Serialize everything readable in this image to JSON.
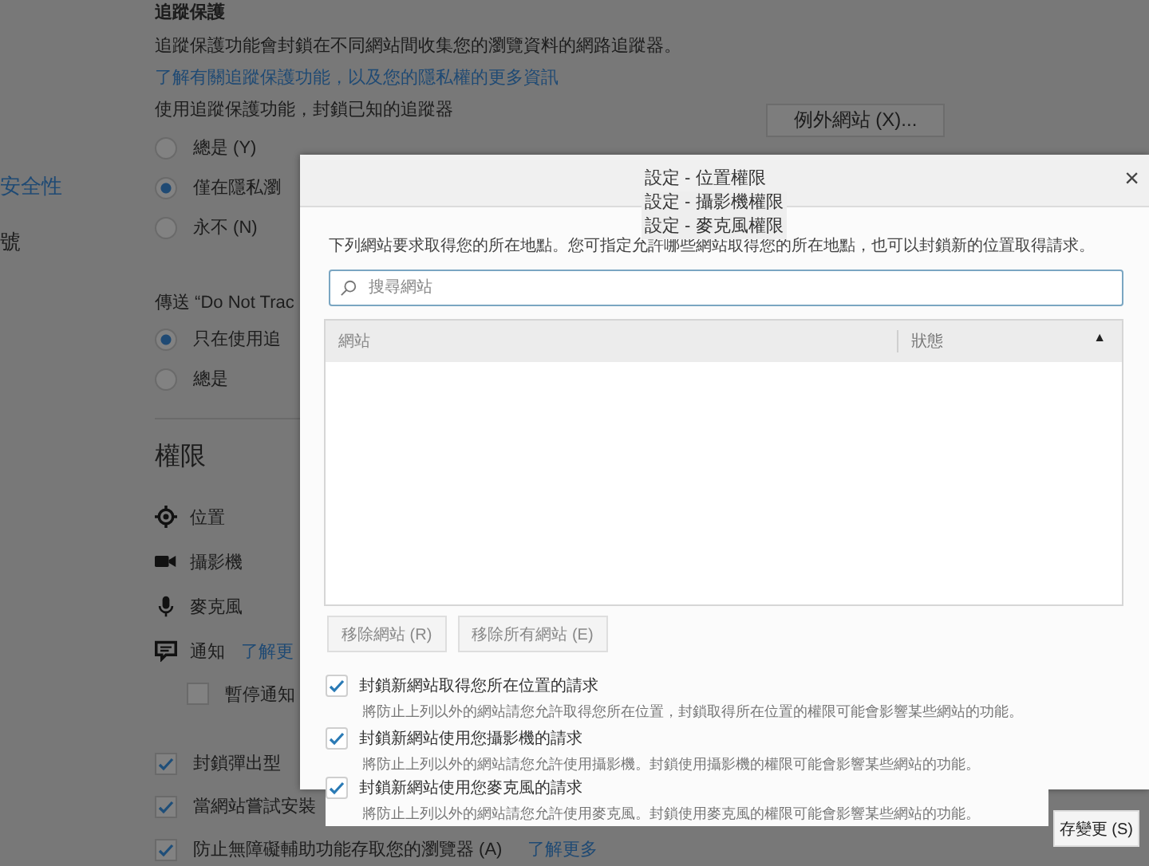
{
  "sidebar": {
    "items": [
      {
        "label": "安全性",
        "selected": true
      },
      {
        "label": "號",
        "selected": false
      }
    ]
  },
  "tracking": {
    "heading": "追蹤保護",
    "description": "追蹤保護功能會封鎖在不同網站間收集您的瀏覽資料的網路追蹤器。",
    "link": "了解有關追蹤保護功能，以及您的隱私權的更多資訊",
    "prompt": "使用追蹤保護功能，封鎖已知的追蹤器",
    "exceptions_button": "例外網站 (X)...",
    "options": [
      {
        "label": "總是 (Y)",
        "selected": false
      },
      {
        "label": "僅在隱私瀏",
        "selected": true
      },
      {
        "label": "永不 (N)",
        "selected": false
      }
    ]
  },
  "dnt": {
    "heading": "傳送 “Do Not Trac",
    "options": [
      {
        "label": "只在使用追",
        "selected": true
      },
      {
        "label": "總是",
        "selected": false
      }
    ]
  },
  "permissions": {
    "heading": "權限",
    "items": [
      {
        "kind": "location",
        "label": "位置"
      },
      {
        "kind": "camera",
        "label": "攝影機"
      },
      {
        "kind": "microphone",
        "label": "麥克風"
      },
      {
        "kind": "notification",
        "label": "通知",
        "link": "了解更"
      }
    ],
    "pause": {
      "label": "暫停通知",
      "checked": false
    }
  },
  "checkboxes": [
    {
      "label": "封鎖彈出型",
      "checked": true
    },
    {
      "label": "當網站嘗試安裝",
      "checked": true
    },
    {
      "label": "防止無障礙輔助功能存取您的瀏覽器 (A)",
      "checked": true,
      "link": "了解更多"
    }
  ],
  "dialog": {
    "titles": [
      "設定 - 位置權限",
      "設定 - 攝影機權限",
      "設定 - 麥克風權限"
    ],
    "close": "×",
    "description": "下列網站要求取得您的所在地點。您可指定允許哪些網站取得您的所在地點，也可以封鎖新的位置取得請求。",
    "search": {
      "placeholder": "搜尋網站"
    },
    "table": {
      "columns": [
        {
          "label": "網站",
          "sorted": false
        },
        {
          "label": "狀態",
          "sorted": true
        }
      ],
      "sort_arrow": "▲"
    },
    "buttons": [
      "移除網站 (R)",
      "移除所有網站 (E)"
    ],
    "options": [
      {
        "label": "封鎖新網站取得您所在位置的請求",
        "note": "將防止上列以外的網站請您允許取得您所在位置，封鎖取得所在位置的權限可能會影響某些網站的功能。",
        "checked": true
      },
      {
        "label": "封鎖新網站使用您攝影機的請求",
        "note": "將防止上列以外的網站請您允許使用攝影機。封鎖使用攝影機的權限可能會影響某些網站的功能。",
        "checked": true
      }
    ],
    "save_button": "存變更 (S)"
  },
  "microphone_panel": {
    "option": {
      "label": "封鎖新網站使用您麥克風的請求",
      "note": "將防止上列以外的網站請您允許使用麥克風。封鎖使用麥克風的權限可能會影響某些網站的功能。",
      "checked": true
    }
  }
}
